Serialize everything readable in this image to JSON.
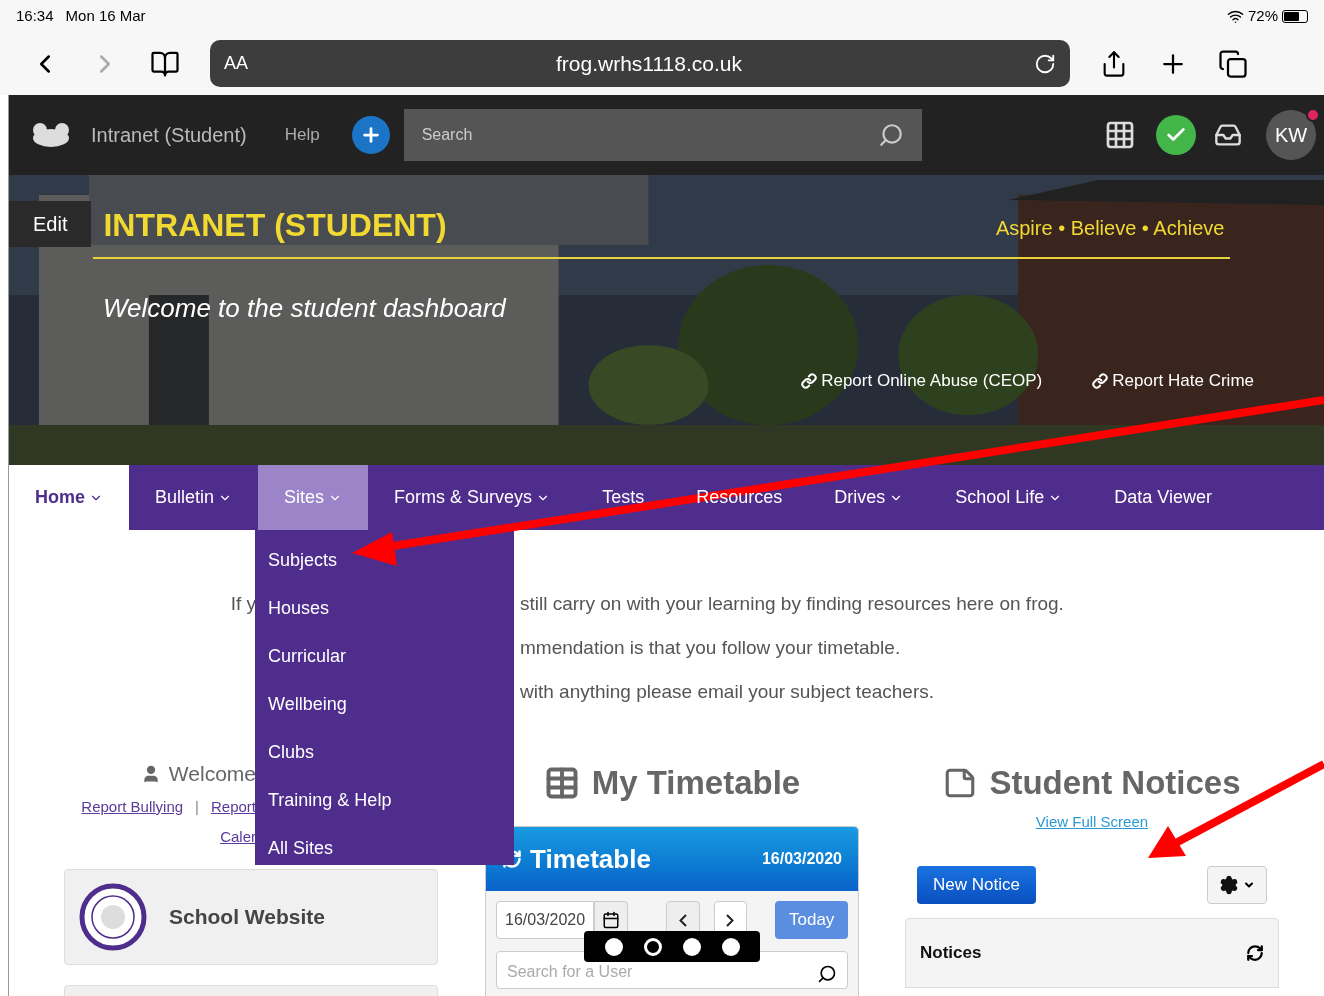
{
  "status_bar": {
    "time": "16:34",
    "date": "Mon 16 Mar",
    "battery_text": "72%"
  },
  "browser": {
    "text_size": "AA",
    "url": "frog.wrhs1118.co.uk"
  },
  "app_bar": {
    "site_name": "Intranet (Student)",
    "help": "Help",
    "search": {
      "placeholder": "Search"
    },
    "avatar": "KW",
    "has_notification": true
  },
  "hero": {
    "edit": "Edit",
    "title": "INTRANET (STUDENT)",
    "motto": "Aspire • Believe • Achieve",
    "subtitle": "Welcome to the student dashboard",
    "links": [
      "Report Online Abuse (CEOP)",
      "Report Hate Crime"
    ]
  },
  "nav": [
    {
      "label": "Home",
      "selected": true,
      "open": false,
      "caret": true
    },
    {
      "label": "Bulletin",
      "selected": false,
      "open": false,
      "caret": true
    },
    {
      "label": "Sites",
      "selected": false,
      "open": true,
      "caret": true
    },
    {
      "label": "Forms & Surveys",
      "selected": false,
      "open": false,
      "caret": true
    },
    {
      "label": "Tests",
      "selected": false,
      "open": false,
      "caret": false
    },
    {
      "label": "Resources",
      "selected": false,
      "open": false,
      "caret": false
    },
    {
      "label": "Drives",
      "selected": false,
      "open": false,
      "caret": true
    },
    {
      "label": "School Life",
      "selected": false,
      "open": false,
      "caret": true
    },
    {
      "label": "Data Viewer",
      "selected": false,
      "open": false,
      "caret": false
    }
  ],
  "dropdown": [
    "Subjects",
    "Houses",
    "Curricular",
    "Wellbeing",
    "Clubs",
    "Training & Help",
    "All Sites"
  ],
  "intro": [
    {
      "left": "If y",
      "right": "still carry on with your learning by finding resources here on frog."
    },
    {
      "right": "mmendation is that you follow your timetable."
    },
    {
      "right": "with anything please email your subject teachers."
    }
  ],
  "left_column": {
    "welcome": "Welcome",
    "links": [
      "Report Bullying",
      "Report"
    ],
    "separator": "|",
    "calendar_link": "Caler",
    "card": "School Website"
  },
  "timetable": {
    "heading": "My Timetable",
    "title": "Timetable",
    "date": "16/03/2020",
    "date_field": "16/03/2020",
    "today": "Today",
    "search": {
      "placeholder": "Search for a User"
    }
  },
  "notices": {
    "heading": "Student Notices",
    "view_full": "View Full Screen",
    "new_notice": "New Notice",
    "panel_title": "Notices"
  },
  "page_dots": [
    {
      "selected": false
    },
    {
      "selected": true
    },
    {
      "selected": false
    },
    {
      "selected": false
    }
  ]
}
